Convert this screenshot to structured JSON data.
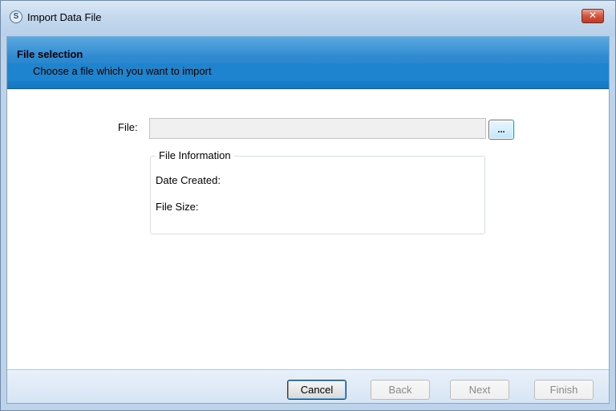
{
  "window": {
    "title": "Import Data File",
    "app_icon_glyph": "S",
    "close_glyph": "✕"
  },
  "header": {
    "title": "File selection",
    "subtitle": "Choose a file which you want to import"
  },
  "file": {
    "label": "File:",
    "value": "",
    "browse_label": "..."
  },
  "file_info": {
    "legend": "File Information",
    "date_created_label": "Date Created:",
    "file_size_label": "File Size:"
  },
  "footer": {
    "cancel_label": "Cancel",
    "back_label": "Back",
    "next_label": "Next",
    "finish_label": "Finish"
  },
  "colors": {
    "header_band": "#1479c4",
    "close_button": "#c03a25",
    "title_bar": "#c5d9ee"
  },
  "icons": [
    "app-icon",
    "close-icon"
  ]
}
